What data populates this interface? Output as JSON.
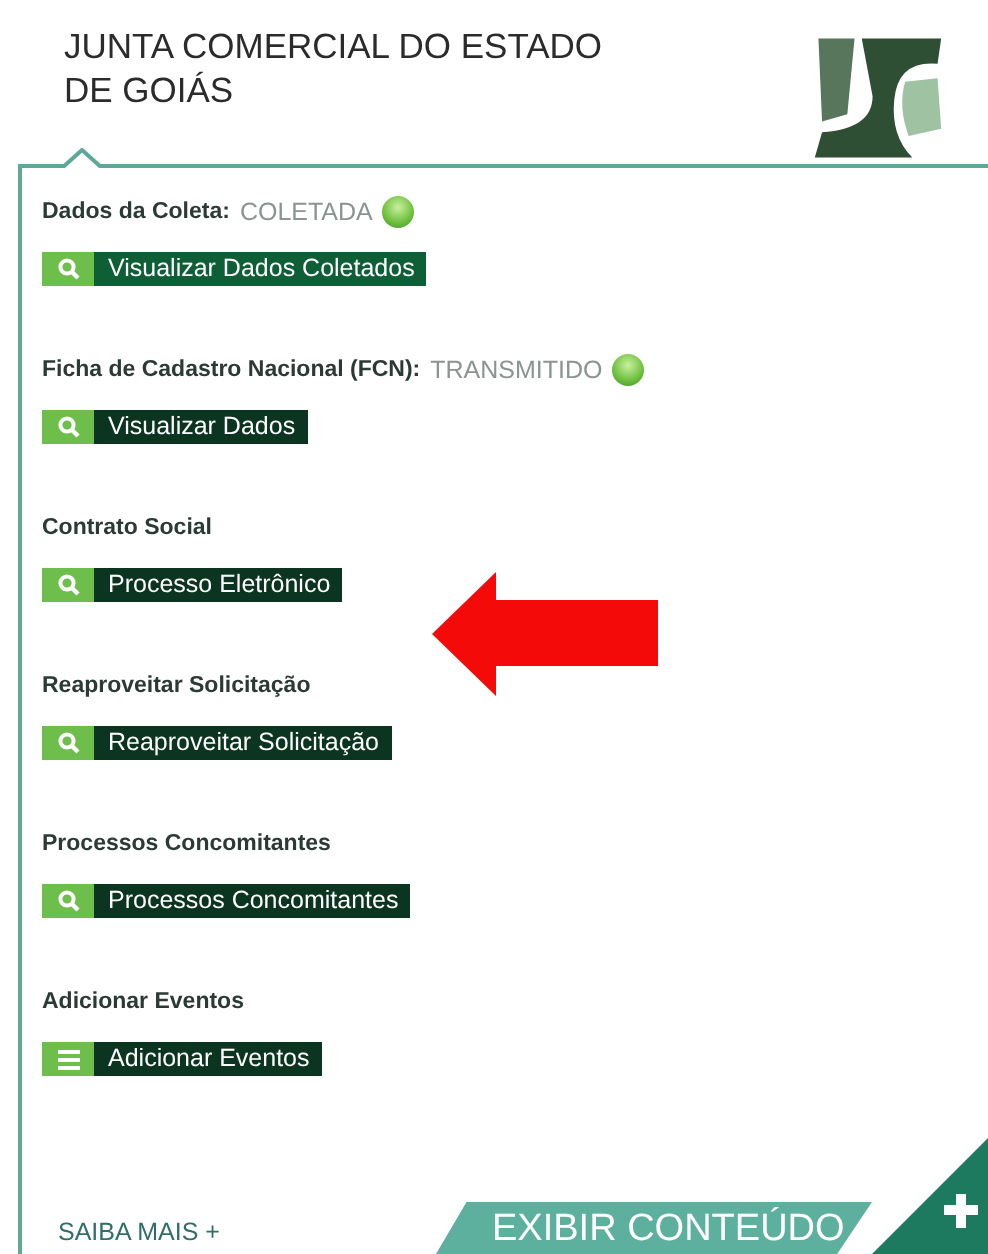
{
  "header": {
    "title": "JUNTA COMERCIAL DO ESTADO DE GOIÁS"
  },
  "sections": [
    {
      "label": "Dados da Coleta:",
      "status": "COLETADA",
      "button": {
        "label": "Visualizar Dados Coletados",
        "kind": "search",
        "color": "#0f5f36"
      }
    },
    {
      "label": "Ficha de Cadastro Nacional (FCN):",
      "status": "TRANSMITIDO",
      "button": {
        "label": "Visualizar Dados",
        "kind": "search",
        "color": "#0b3520"
      }
    },
    {
      "label": "Contrato Social",
      "button": {
        "label": "Processo Eletrônico",
        "kind": "search",
        "color": "#0b3520"
      }
    },
    {
      "label": "Reaproveitar Solicitação",
      "button": {
        "label": "Reaproveitar Solicitação",
        "kind": "search",
        "color": "#0b3520"
      }
    },
    {
      "label": "Processos Concomitantes",
      "button": {
        "label": "Processos Concomitantes",
        "kind": "search",
        "color": "#0b3520"
      }
    },
    {
      "label": "Adicionar Eventos",
      "button": {
        "label": "Adicionar Eventos",
        "kind": "list",
        "color": "#0b3520"
      }
    }
  ],
  "footer": {
    "more_link": "SAIBA MAIS +",
    "show_content": "EXIBIR CONTEÚDO"
  }
}
